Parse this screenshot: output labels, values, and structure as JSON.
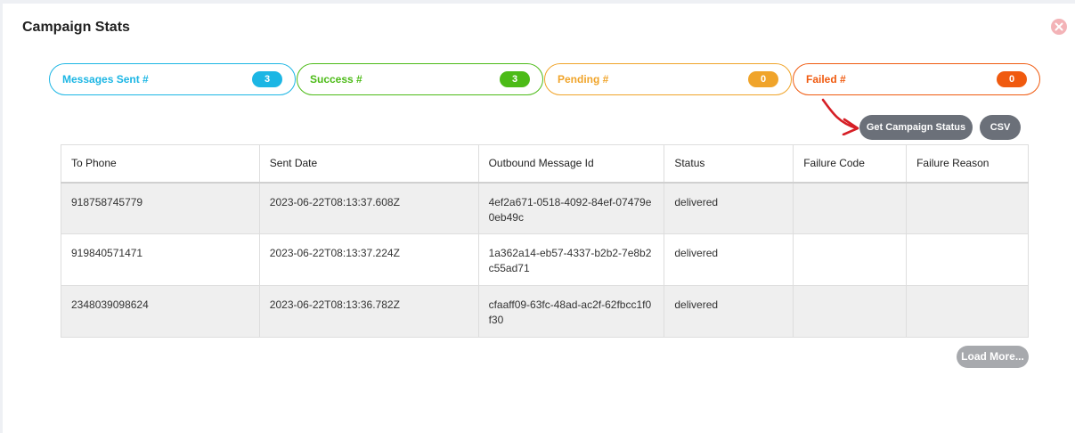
{
  "modal": {
    "title": "Campaign Stats",
    "close_icon": "close-circle-icon"
  },
  "stats": [
    {
      "label": "Messages Sent #",
      "count": "3",
      "color": "#1cb6e4"
    },
    {
      "label": "Success #",
      "count": "3",
      "color": "#4cbb17"
    },
    {
      "label": "Pending #",
      "count": "0",
      "color": "#f0a42a"
    },
    {
      "label": "Failed #",
      "count": "0",
      "color": "#f05a0f"
    }
  ],
  "actions": {
    "get_status_label": "Get Campaign Status",
    "csv_label": "CSV",
    "load_more_label": "Load More..."
  },
  "table": {
    "columns": [
      "To Phone",
      "Sent Date",
      "Outbound Message Id",
      "Status",
      "Failure Code",
      "Failure Reason"
    ],
    "rows": [
      [
        "918758745779",
        "2023-06-22T08:13:37.608Z",
        "4ef2a671-0518-4092-84ef-07479e0eb49c",
        "delivered",
        "",
        ""
      ],
      [
        "919840571471",
        "2023-06-22T08:13:37.224Z",
        "1a362a14-eb57-4337-b2b2-7e8b2c55ad71",
        "delivered",
        "",
        ""
      ],
      [
        "2348039098624",
        "2023-06-22T08:13:36.782Z",
        "cfaaff09-63fc-48ad-ac2f-62fbcc1f0f30",
        "delivered",
        "",
        ""
      ]
    ]
  }
}
